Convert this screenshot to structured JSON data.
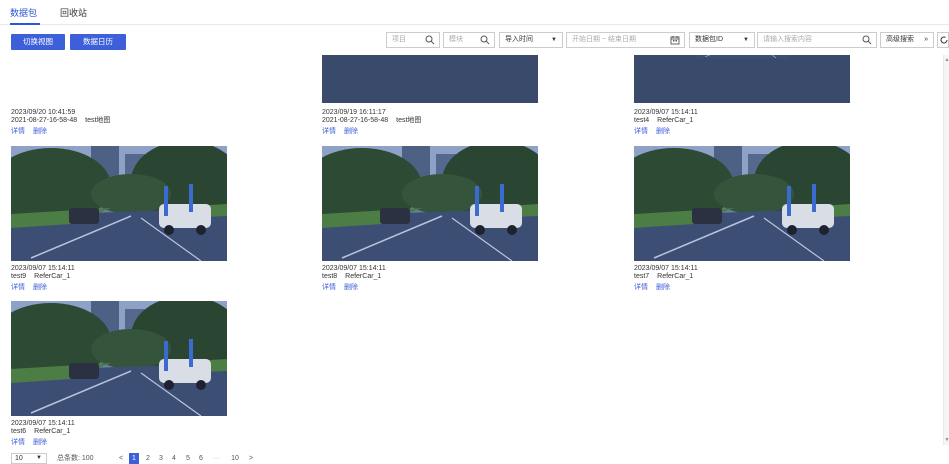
{
  "tabs": [
    {
      "label": "数据包",
      "active": true
    },
    {
      "label": "回收站",
      "active": false
    }
  ],
  "toolbar": {
    "switch_view": "切换视图",
    "data_calendar": "数据日历",
    "project_placeholder": "项目",
    "module_placeholder": "模块",
    "import_time": "导入时间",
    "date_range_placeholder": "开始日期 ~ 结束日期",
    "package_id": "数据包ID",
    "search_placeholder": "请输入搜索内容",
    "advanced_search": "高级搜索"
  },
  "cards": [
    {
      "time": "2023/09/20 10:41:59",
      "name": "2021-08-27-16-58-48",
      "tag": "test地图",
      "detail": "详情",
      "delete": "删除"
    },
    {
      "time": "2023/09/19 16:11:17",
      "name": "2021-08-27-16-58-48",
      "tag": "test地图",
      "detail": "详情",
      "delete": "删除"
    },
    {
      "time": "2023/09/07 15:14:11",
      "name": "test4",
      "tag": "ReferCar_1",
      "detail": "详情",
      "delete": "删除"
    },
    {
      "time": "2023/09/07 15:14:11",
      "name": "test9",
      "tag": "ReferCar_1",
      "detail": "详情",
      "delete": "删除"
    },
    {
      "time": "2023/09/07 15:14:11",
      "name": "test8",
      "tag": "ReferCar_1",
      "detail": "详情",
      "delete": "删除"
    },
    {
      "time": "2023/09/07 15:14:11",
      "name": "test7",
      "tag": "ReferCar_1",
      "detail": "详情",
      "delete": "删除"
    },
    {
      "time": "2023/09/07 15:14:11",
      "name": "test6",
      "tag": "ReferCar_1",
      "detail": "详情",
      "delete": "删除"
    }
  ],
  "pagination": {
    "page_size": "10",
    "total_label": "总条数: 100",
    "prev": "<",
    "pages": [
      "1",
      "2",
      "3",
      "4",
      "5",
      "6",
      "···",
      "10"
    ],
    "current": "1",
    "next": ">"
  },
  "colors": {
    "accent": "#3d5fd9",
    "tab_active": "#2c57d6"
  }
}
